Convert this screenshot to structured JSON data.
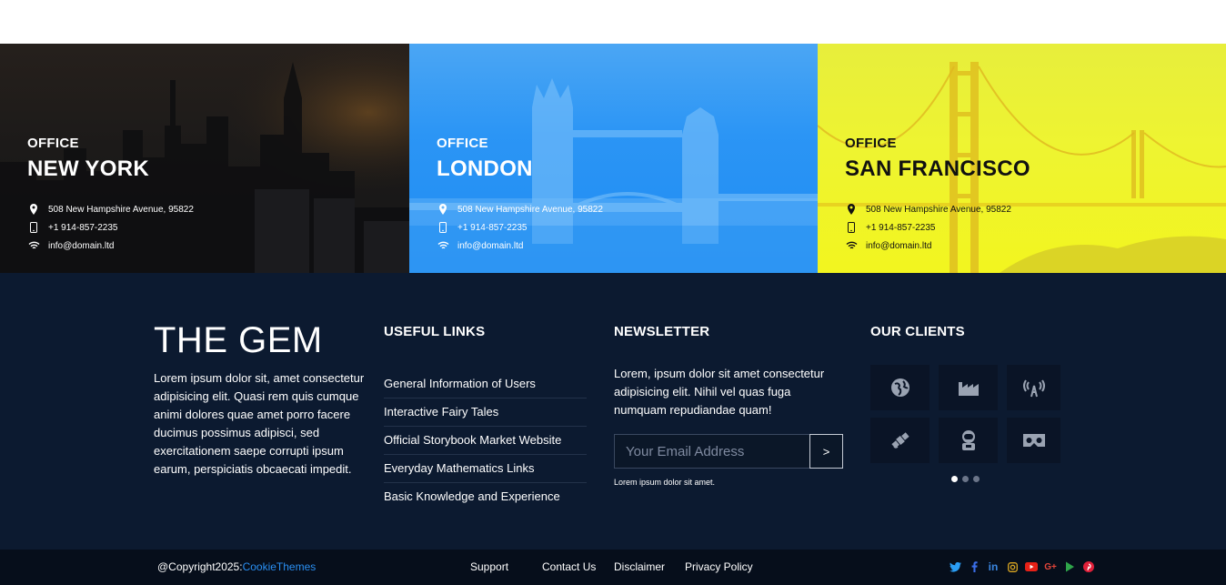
{
  "offices": [
    {
      "kicker": "OFFICE",
      "city": "NEW YORK",
      "address": "508 New Hampshire Avenue, 95822",
      "phone": "+1 914-857-2235",
      "email": "info@domain.ltd"
    },
    {
      "kicker": "OFFICE",
      "city": "LONDON",
      "address": "508 New Hampshire Avenue, 95822",
      "phone": "+1 914-857-2235",
      "email": "info@domain.ltd"
    },
    {
      "kicker": "OFFICE",
      "city": "SAN FRANCISCO",
      "address": "508 New Hampshire Avenue, 95822",
      "phone": "+1 914-857-2235",
      "email": "info@domain.ltd"
    }
  ],
  "brand": {
    "title": "THE GEM",
    "text": "Lorem ipsum dolor sit, amet consectetur adipisicing elit. Quasi rem quis cumque animi dolores quae amet porro facere ducimus possimus adipisci, sed exercitationem saepe corrupti ipsum earum, perspiciatis obcaecati impedit."
  },
  "useful_links": {
    "title": "USEFUL LINKS",
    "items": [
      "General Information of Users",
      "Interactive Fairy Tales",
      "Official Storybook Market Website",
      "Everyday Mathematics Links",
      "Basic Knowledge and Experience"
    ]
  },
  "newsletter": {
    "title": "NEWSLETTER",
    "text": "Lorem, ipsum dolor sit amet consectetur adipisicing elit. Nihil vel quas fuga numquam repudiandae quam!",
    "placeholder": "Your Email Address",
    "button": ">",
    "note": "Lorem ipsum dolor sit amet."
  },
  "clients": {
    "title": "OUR CLIENTS",
    "icons": [
      "globe-icon",
      "factory-icon",
      "broadcast-icon",
      "satellite-icon",
      "astronaut-icon",
      "vr-headset-icon"
    ]
  },
  "bottombar": {
    "copyright_prefix": "@Copyright2025:",
    "copyright_link": "CookieThemes",
    "nav": [
      "Support",
      "Contact Us",
      "Disclaimer",
      "Privacy Policy"
    ],
    "social": [
      "twitter-icon",
      "facebook-icon",
      "linkedin-icon",
      "instagram-icon",
      "youtube-icon",
      "google-plus-icon",
      "play-store-icon",
      "pinterest-icon"
    ]
  },
  "colors": {
    "footer_bg": "#0c1a30",
    "bottombar_bg": "#060e1b",
    "accent_link": "#2a8ff2",
    "london_blue": "#1f8cf2",
    "sf_yellow": "#f2f51f"
  }
}
